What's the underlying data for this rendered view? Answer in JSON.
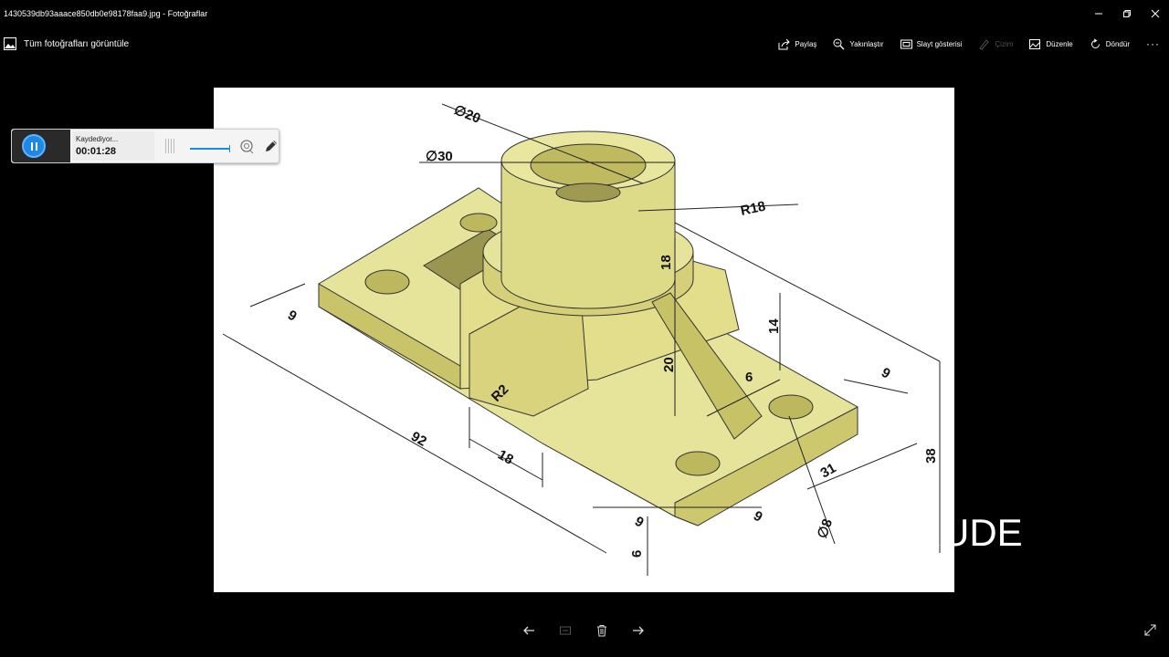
{
  "window": {
    "title": "1430539db93aaace850db0e98178faa9.jpg - Fotoğraflar"
  },
  "toolbar": {
    "view_all_label": "Tüm fotoğrafları görüntüle",
    "actions": [
      {
        "label": "Paylaş",
        "icon": "share-icon",
        "enabled": true
      },
      {
        "label": "Yakınlaştır",
        "icon": "zoom-icon",
        "enabled": true
      },
      {
        "label": "Slayt gösterisi",
        "icon": "slideshow-icon",
        "enabled": true
      },
      {
        "label": "Çizim",
        "icon": "draw-icon",
        "enabled": false
      },
      {
        "label": "Düzenle",
        "icon": "edit-icon",
        "enabled": true
      },
      {
        "label": "Döndür",
        "icon": "rotate-icon",
        "enabled": true
      }
    ],
    "more_label": "···"
  },
  "recorder": {
    "status": "Kaydediyor...",
    "time": "00:01:28"
  },
  "drawing": {
    "dims": {
      "d20": "∅20",
      "d30": "∅30",
      "r18": "R18",
      "v18": "18",
      "v14": "14",
      "v20": "20",
      "v6": "6",
      "v9a": "9",
      "v9b": "9",
      "v9c": "9",
      "v9d": "9",
      "v92": "92",
      "r2": "R2",
      "v18b": "18",
      "v31": "31",
      "v38": "38",
      "d8": "∅8",
      "v6b": "6"
    }
  },
  "overlay_text": "TRUDE",
  "colors": {
    "accent": "#1e88e5",
    "part_fill": "#e6e39a",
    "part_shade": "#c9c46a"
  }
}
